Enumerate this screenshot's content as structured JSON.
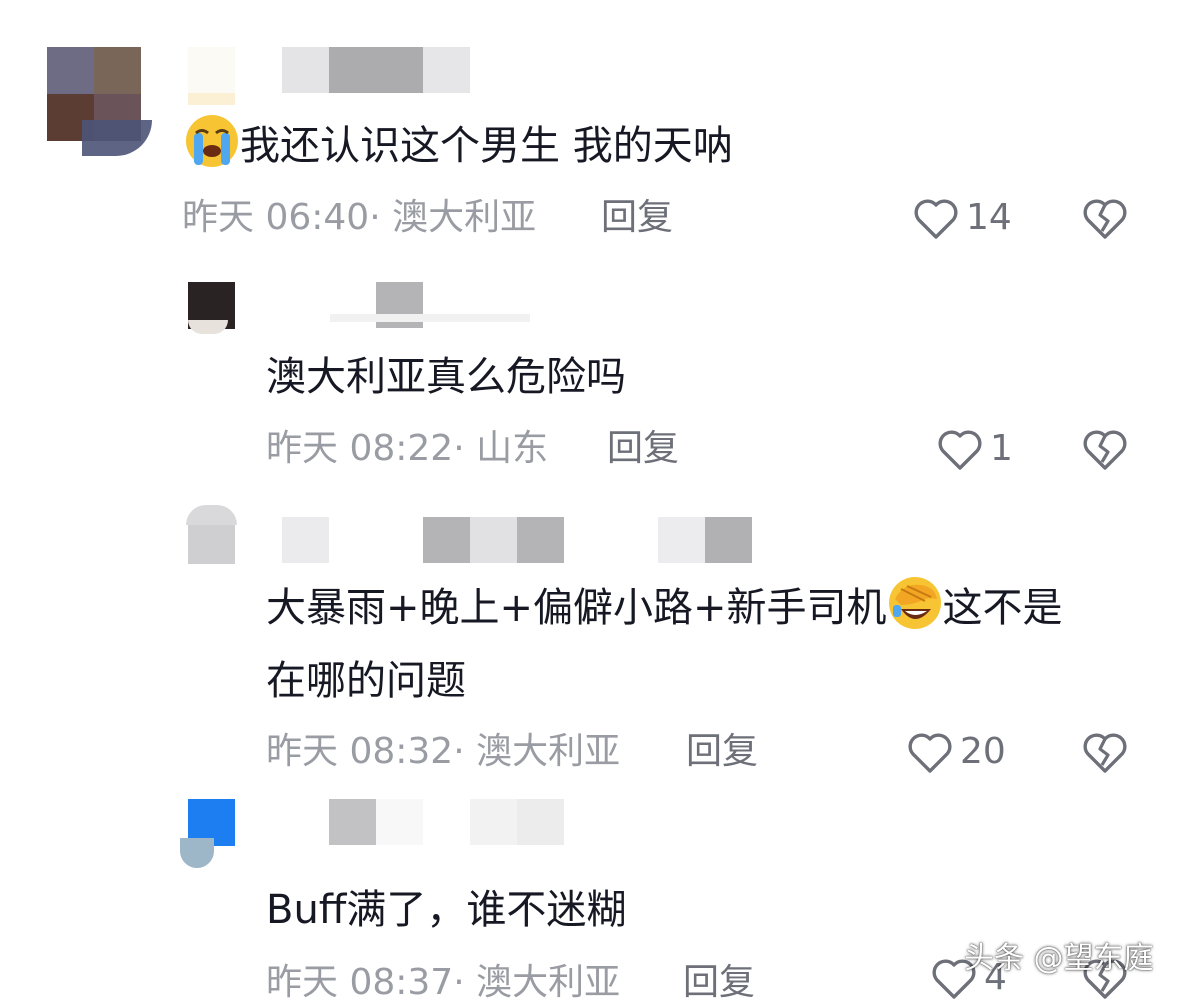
{
  "comments": [
    {
      "text": "我还认识这个男生 我的天呐",
      "emoji": "loudly-crying-face",
      "meta": "昨天 06:40· 澳大利亚",
      "reply_label": "回复",
      "likes": "14"
    },
    {
      "text": "澳大利亚真么危险吗",
      "meta": "昨天 08:22· 山东",
      "reply_label": "回复",
      "likes": "1"
    },
    {
      "text_line1_a": "大暴雨+晚上+偏僻小路+新手司机",
      "text_line1_b": "这不是",
      "text_line2": "在哪的问题",
      "emoji": "face-palm-laughing",
      "meta": "昨天 08:32· 澳大利亚",
      "reply_label": "回复",
      "likes": "20"
    },
    {
      "text": "Buff满了，谁不迷糊",
      "meta": "昨天 08:37· 澳大利亚",
      "reply_label": "回复",
      "likes": "4"
    }
  ],
  "icons": {
    "like": "heart-outline-icon",
    "dislike": "broken-heart-icon"
  },
  "colors": {
    "text": "#161823",
    "meta": "#9a9ca3",
    "action": "#6e7079"
  },
  "watermark": "头条 @望东庭"
}
